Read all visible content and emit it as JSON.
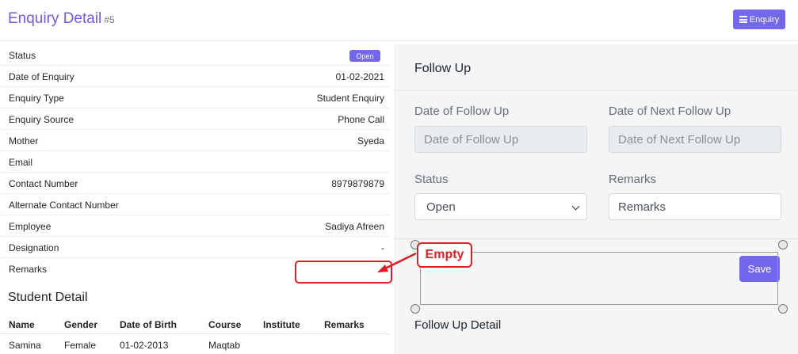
{
  "header": {
    "title": "Enquiry Detail",
    "number": "#5",
    "enquiry_button": "Enquiry",
    "enquiry_icon": "list-icon"
  },
  "details": [
    {
      "label": "Status",
      "value": "",
      "badge": "Open"
    },
    {
      "label": "Date of Enquiry",
      "value": "01-02-2021"
    },
    {
      "label": "Enquiry Type",
      "value": "Student Enquiry"
    },
    {
      "label": "Enquiry Source",
      "value": "Phone Call"
    },
    {
      "label": "Mother",
      "value": "Syeda"
    },
    {
      "label": "Email",
      "value": ""
    },
    {
      "label": "Contact Number",
      "value": "8979879879"
    },
    {
      "label": "Alternate Contact Number",
      "value": ""
    },
    {
      "label": "Employee",
      "value": "Sadiya Afreen"
    },
    {
      "label": "Designation",
      "value": "-"
    },
    {
      "label": "Remarks",
      "value": ""
    }
  ],
  "student_detail": {
    "heading": "Student Detail",
    "columns": [
      "Name",
      "Gender",
      "Date of Birth",
      "Course",
      "Institute",
      "Remarks"
    ],
    "rows": [
      [
        "Samina",
        "Female",
        "01-02-2013",
        "Maqtab",
        "",
        ""
      ]
    ]
  },
  "follow_up": {
    "title": "Follow Up",
    "date_label": "Date of Follow Up",
    "date_placeholder": "Date of Follow Up",
    "next_date_label": "Date of Next Follow Up",
    "next_date_placeholder": "Date of Next Follow Up",
    "status_label": "Status",
    "status_value": "Open",
    "remarks_label": "Remarks",
    "remarks_placeholder": "Remarks",
    "save_label": "Save",
    "detail_title": "Follow Up Detail"
  },
  "annotation": {
    "label": "Empty",
    "color": "#dc1f26"
  },
  "colors": {
    "accent": "#7367f0"
  }
}
